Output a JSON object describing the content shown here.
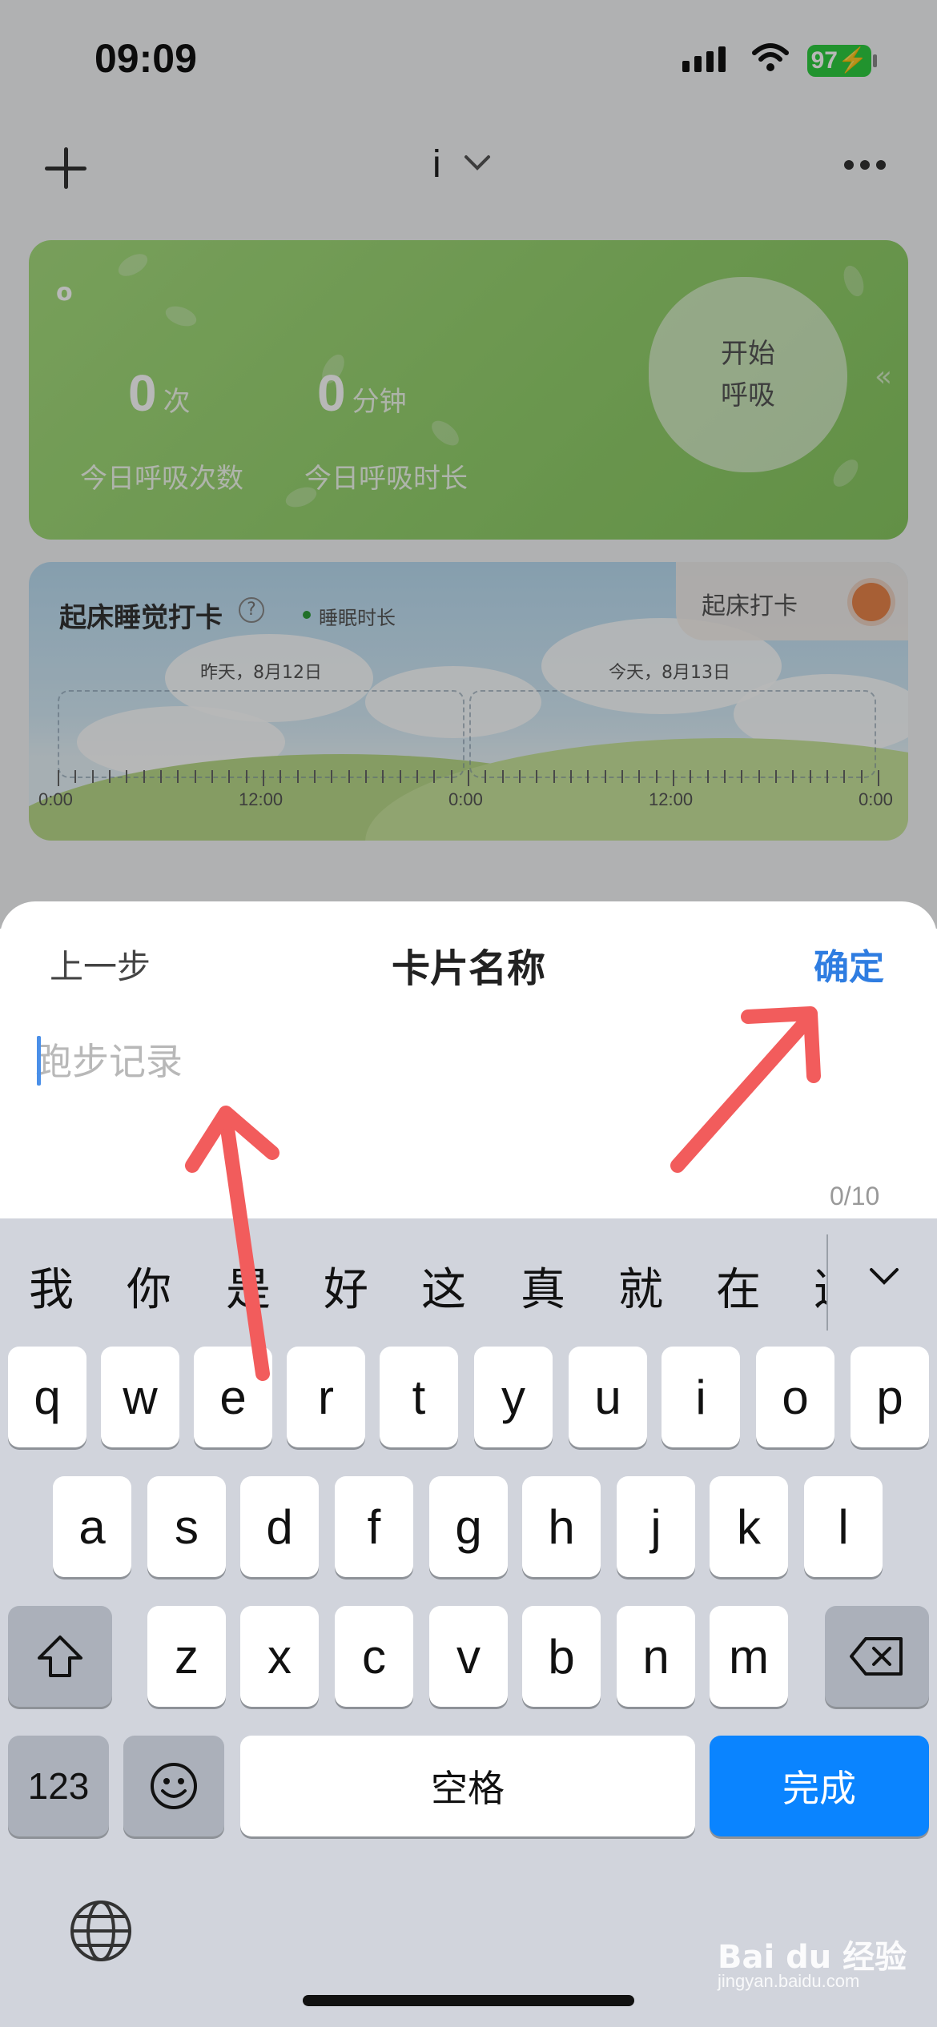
{
  "status_bar": {
    "time": "09:09",
    "battery": "97"
  },
  "header": {
    "title": "i"
  },
  "breath_card": {
    "label": "o",
    "count_value": "0",
    "count_unit": "次",
    "duration_value": "0",
    "duration_unit": "分钟",
    "count_label": "今日呼吸次数",
    "duration_label": "今日呼吸时长",
    "start_label": "开始呼吸"
  },
  "sleep_card": {
    "title": "起床睡觉打卡",
    "help": "?",
    "legend": "睡眠时长",
    "checkin_label": "起床打卡",
    "day_labels": [
      "昨天，8月12日",
      "今天，8月13日"
    ],
    "tick_labels": [
      "0:00",
      "12:00",
      "0:00",
      "12:00",
      "0:00"
    ]
  },
  "sheet": {
    "back_label": "上一步",
    "title": "卡片名称",
    "confirm_label": "确定",
    "input_placeholder": "跑步记录",
    "input_value": "",
    "char_count": "0/10"
  },
  "keyboard": {
    "candidates": [
      "我",
      "你",
      "是",
      "好",
      "这",
      "真",
      "就",
      "在",
      "这"
    ],
    "row1": [
      "q",
      "w",
      "e",
      "r",
      "t",
      "y",
      "u",
      "i",
      "o",
      "p"
    ],
    "row2": [
      "a",
      "s",
      "d",
      "f",
      "g",
      "h",
      "j",
      "k",
      "l"
    ],
    "row3": [
      "z",
      "x",
      "c",
      "v",
      "b",
      "n",
      "m"
    ],
    "numbers_label": "123",
    "space_label": "空格",
    "done_label": "完成"
  },
  "watermark": {
    "brand": "Bai du 经验",
    "url": "jingyan.baidu.com"
  },
  "colors": {
    "accent": "#2f7de1",
    "done_key": "#0a84ff",
    "breath_card": "#93d06c",
    "annotation_arrow": "#f25c5c"
  }
}
